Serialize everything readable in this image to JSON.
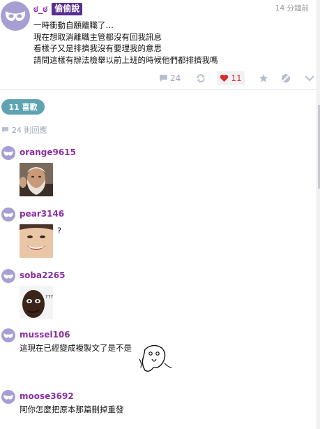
{
  "post": {
    "author_handle": "ಠ_ಠ",
    "badge": "偷偷說",
    "timestamp": "14 分鐘前",
    "lines": [
      "一時衝動自願離職了…",
      "現在想取消離職主管都沒有回我訊息",
      "看樣子又是排擠我沒有要理我的意思",
      "請問這樣有辦法檢舉以前上班的時候他們都排擠我嗎"
    ],
    "actions": {
      "comment_count": "24",
      "like_count": "11"
    }
  },
  "likes_pill": "11 喜歡",
  "replies_label": "24 則回應",
  "comments": [
    {
      "name": "orange9615",
      "text": ""
    },
    {
      "name": "pear3146",
      "text": "?"
    },
    {
      "name": "soba2265",
      "text": "???"
    },
    {
      "name": "mussel106",
      "text": "這現在已經變成複製文了是不是"
    },
    {
      "name": "moose3692",
      "text": "阿你怎麼把原本那篇刪掉重發"
    }
  ],
  "colors": {
    "accent_purple": "#8c2fa5",
    "badge_bg": "#5a2d91",
    "avatar": "#a79ed4",
    "pill_teal": "#5da3b2",
    "like_red": "#d32f2f",
    "muted": "#9aa3b5"
  },
  "icons": {
    "avatar": "masquerade-mask-icon",
    "comment": "speech-bubble-icon",
    "refresh": "refresh-icon",
    "like": "heart-icon",
    "star": "star-icon",
    "ban": "ban-icon",
    "more": "chevron-down-icon"
  }
}
